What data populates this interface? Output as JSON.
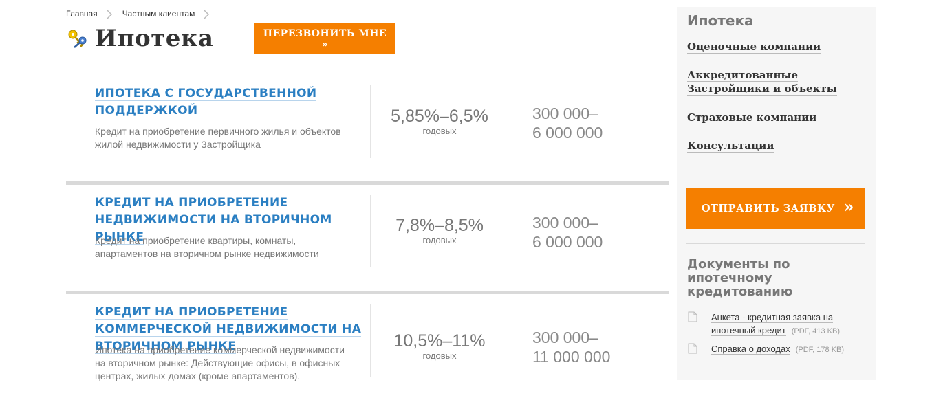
{
  "breadcrumb": [
    "Главная",
    "Частным клиентам"
  ],
  "page": {
    "title": "Ипотека",
    "callback_label": "ПЕРЕЗВОНИТЬ МНЕ »"
  },
  "products": [
    {
      "name": "ИПОТЕКА С ГОСУДАРСТВЕННОЙ ПОДДЕРЖКОЙ",
      "description": "Кредит на приобретение первичного жилья и объектов жилой недвижимости у Застройщика",
      "rate": "5,85%–6,5%",
      "rate_unit": "годовых",
      "amount_from": "300 000–",
      "amount_to": "6 000 000"
    },
    {
      "name": "КРЕДИТ НА ПРИОБРЕТЕНИЕ НЕДВИЖИМОСТИ НА ВТОРИЧНОМ РЫНКЕ",
      "description": "Кредит на приобретение квартиры, комнаты, апартаментов на вторичном рынке недвижимости",
      "rate": "7,8%–8,5%",
      "rate_unit": "годовых",
      "amount_from": "300 000–",
      "amount_to": "6 000 000"
    },
    {
      "name": "КРЕДИТ НА ПРИОБРЕТЕНИЕ КОММЕРЧЕСКОЙ НЕДВИЖИМОСТИ НА ВТОРИЧНОМ РЫНКЕ",
      "description": "Ипотека на приобретение коммерческой недвижимости на вторичном рынке: Действующие офисы, в офисных центрах, жилых домах (кроме апартаментов).",
      "rate": "10,5%–11%",
      "rate_unit": "годовых",
      "amount_from": "300 000–",
      "amount_to": "11 000 000"
    }
  ],
  "sidebar": {
    "title": "Ипотека",
    "links": [
      "Оценочные компании",
      "Аккредитованные Застройщики и объекты",
      "Страховые компании",
      "Консультации"
    ],
    "apply_label": "ОТПРАВИТЬ ЗАЯВКУ",
    "apply_arrow": "»",
    "docs_title": "Документы по ипотечному кредитованию",
    "documents": [
      {
        "title": "Анкета - кредитная заявка на ипотечный кредит",
        "meta": "(PDF, 413 KB)"
      },
      {
        "title": "Справка о доходах",
        "meta": "(PDF, 178 KB)"
      }
    ]
  },
  "colors": {
    "accent": "#f57f00",
    "link_blue": "#2b7fc2",
    "divider": "#d9d9d9",
    "sidebar_bg": "#f6f6f6"
  },
  "icons": [
    "chevron-right-icon",
    "keys-icon",
    "document-icon"
  ]
}
